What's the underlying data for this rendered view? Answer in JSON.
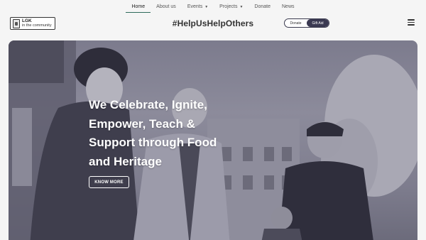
{
  "topnav": {
    "items": [
      {
        "label": "Home",
        "active": true
      },
      {
        "label": "About us"
      },
      {
        "label": "Events",
        "dropdown": true
      },
      {
        "label": "Projects",
        "dropdown": true
      },
      {
        "label": "Donate"
      },
      {
        "label": "News"
      }
    ],
    "accent_color": "#2e6b5a"
  },
  "header": {
    "logo": {
      "line1": "LGK",
      "line2": "in the community"
    },
    "hashtag": "#HelpUsHelpOthers",
    "toggle": {
      "donate_label": "Donate",
      "giftaid_label": "Gift Aid",
      "selected": "Gift Aid",
      "selected_color": "#3b3a52"
    },
    "menu_icon": "hamburger-menu-icon"
  },
  "hero": {
    "title": "We Celebrate, Ignite, Empower, Teach & Support through Food and Heritage",
    "button_label": "KNOW MORE",
    "overlay_color": "#7c7b8d"
  }
}
